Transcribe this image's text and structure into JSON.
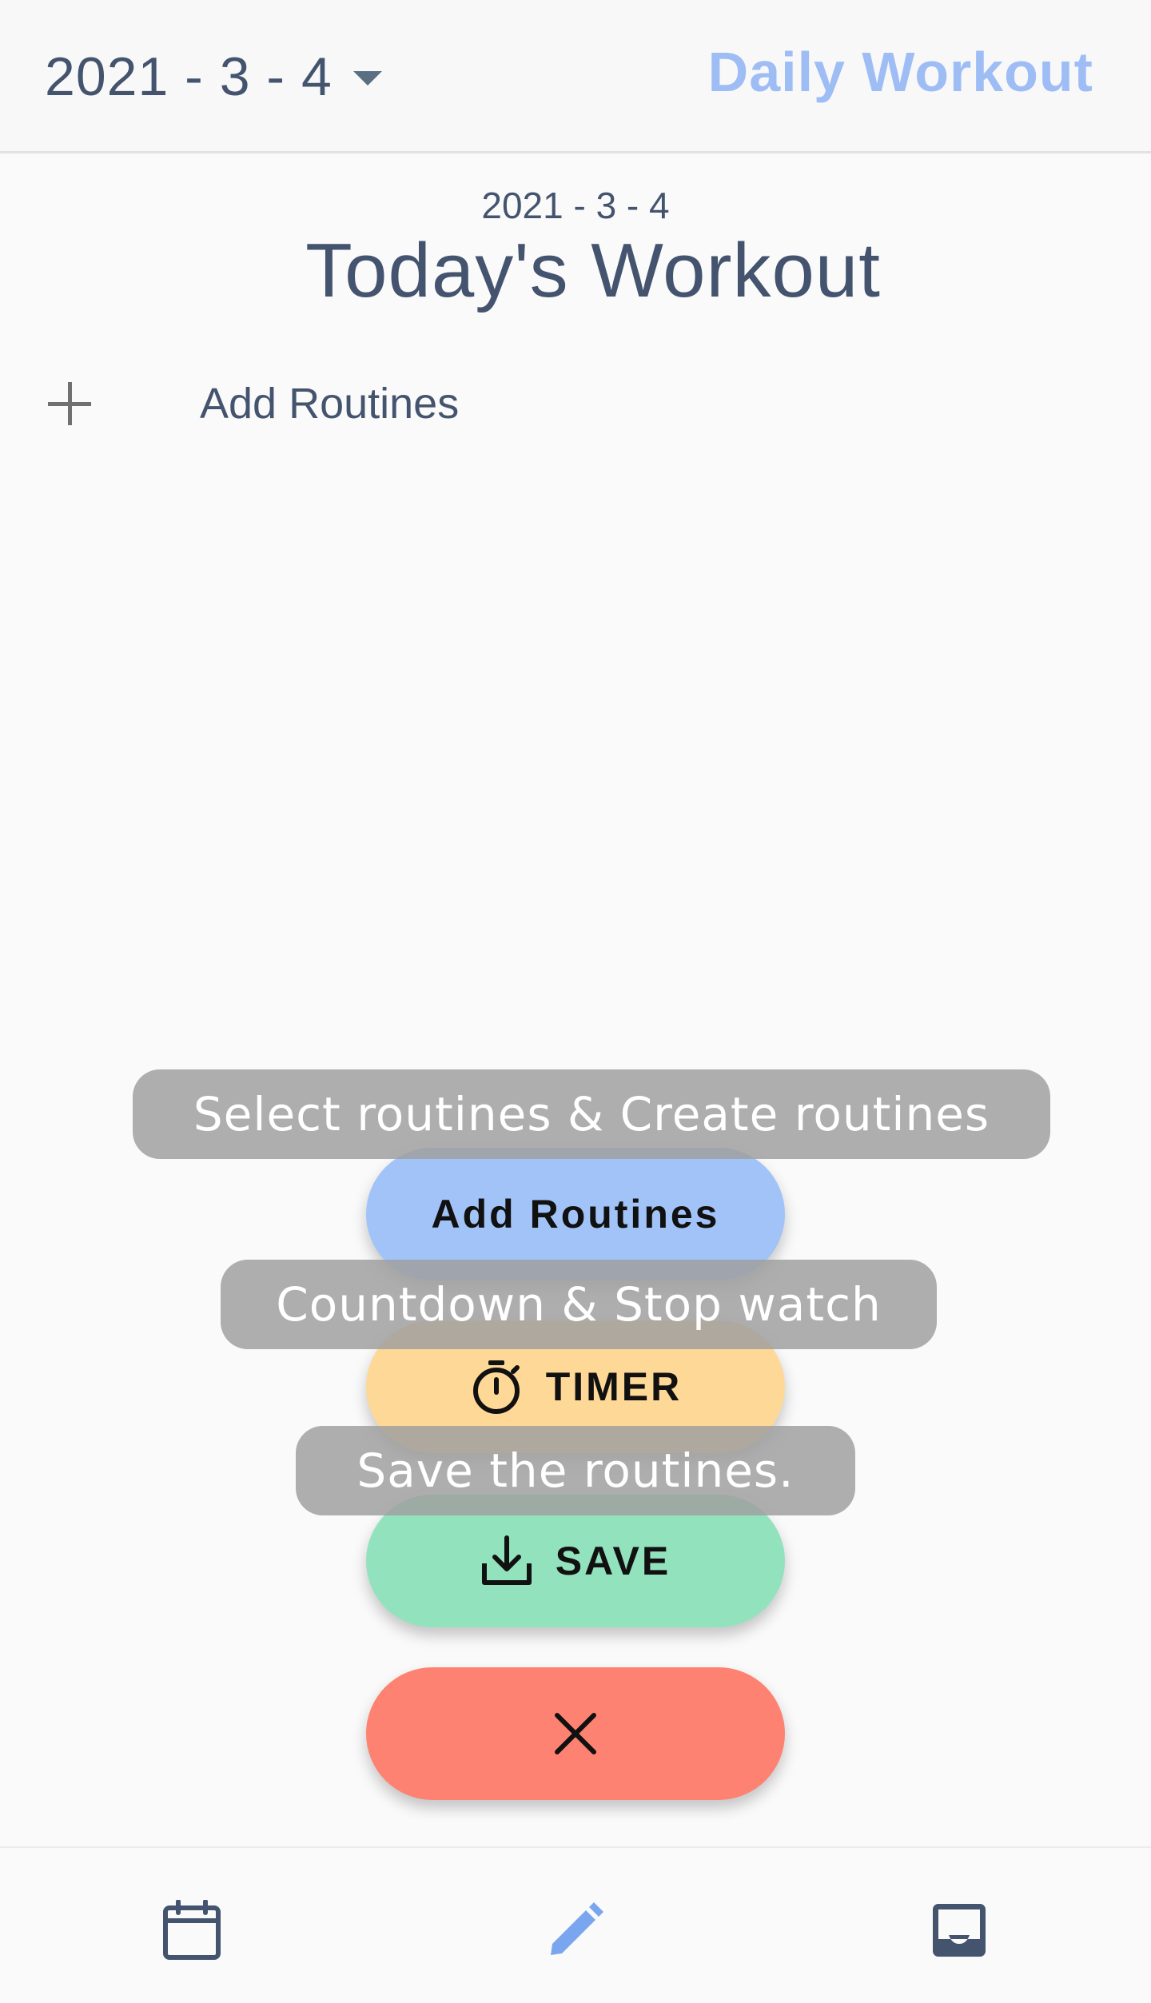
{
  "appbar": {
    "date_selector": "2021 - 3 - 4",
    "title": "Daily Workout",
    "title_color": "#9fbdf5"
  },
  "main": {
    "date": "2021 - 3 - 4",
    "title": "Today's Workout",
    "add_routines_label": "Add Routines",
    "add_icon": "plus-icon"
  },
  "speed_dial": {
    "add": {
      "tooltip": "Select routines & Create routines",
      "label": "Add Routines",
      "color": "#a2c3f8"
    },
    "timer": {
      "tooltip": "Countdown & Stop watch",
      "label": "TIMER",
      "icon": "timer-icon",
      "color": "#fed896"
    },
    "save": {
      "tooltip": "Save the routines.",
      "label": "SAVE",
      "icon": "download-icon",
      "color": "#92e2bd"
    },
    "close": {
      "icon": "close-icon",
      "color": "#fd8271"
    }
  },
  "bottom_nav": {
    "items": [
      {
        "icon": "calendar-icon",
        "active": false
      },
      {
        "icon": "edit-icon",
        "active": true,
        "color": "#7aa6ef"
      },
      {
        "icon": "inbox-icon",
        "active": false
      }
    ]
  }
}
